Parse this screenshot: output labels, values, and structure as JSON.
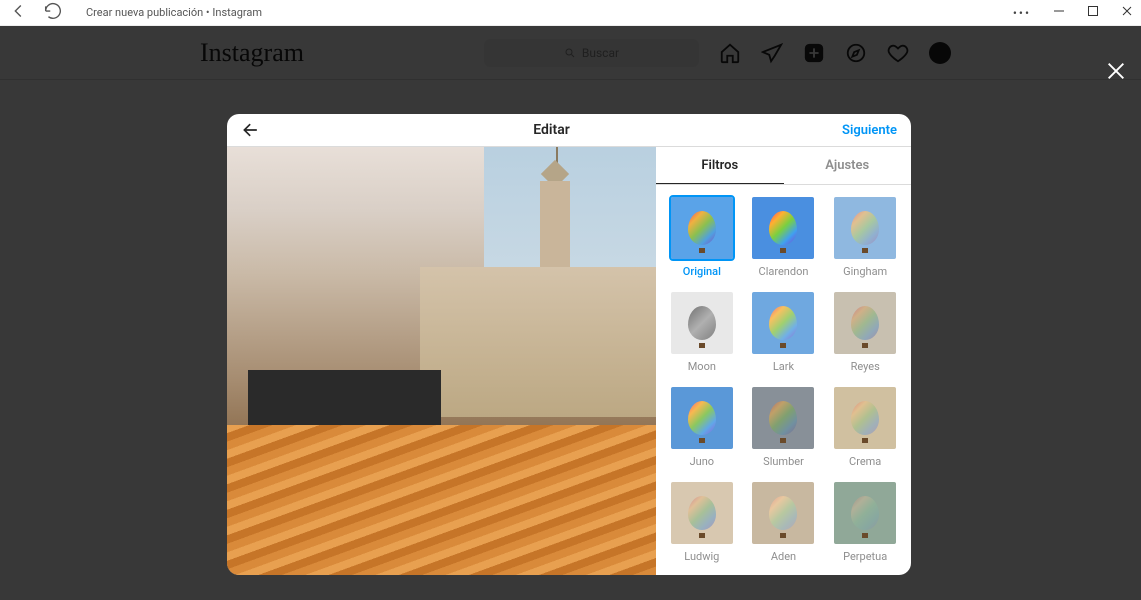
{
  "window": {
    "title": "Crear nueva publicación • Instagram",
    "more_icon": "more-icon",
    "minimize_icon": "minimize-icon",
    "maximize_icon": "maximize-icon",
    "close_icon": "close-icon"
  },
  "topbar": {
    "brand": "Instagram",
    "search_placeholder": "Buscar"
  },
  "modal": {
    "title": "Editar",
    "next": "Siguiente",
    "tab_filters": "Filtros",
    "tab_adjust": "Ajustes",
    "filters": [
      {
        "label": "Original",
        "bg": "bg-original",
        "bal": "bal-original",
        "selected": true
      },
      {
        "label": "Clarendon",
        "bg": "bg-clarendon",
        "bal": "bal-clarendon",
        "selected": false
      },
      {
        "label": "Gingham",
        "bg": "bg-gingham",
        "bal": "bal-gingham",
        "selected": false
      },
      {
        "label": "Moon",
        "bg": "bg-moon",
        "bal": "bal-moon",
        "selected": false
      },
      {
        "label": "Lark",
        "bg": "bg-lark",
        "bal": "bal-lark",
        "selected": false
      },
      {
        "label": "Reyes",
        "bg": "bg-reyes",
        "bal": "bal-reyes",
        "selected": false
      },
      {
        "label": "Juno",
        "bg": "bg-juno",
        "bal": "bal-juno",
        "selected": false
      },
      {
        "label": "Slumber",
        "bg": "bg-slumber",
        "bal": "bal-slumber",
        "selected": false
      },
      {
        "label": "Crema",
        "bg": "bg-crema",
        "bal": "bal-crema",
        "selected": false
      },
      {
        "label": "Ludwig",
        "bg": "bg-ludwig",
        "bal": "bal-ludwig",
        "selected": false
      },
      {
        "label": "Aden",
        "bg": "bg-aden",
        "bal": "bal-aden",
        "selected": false
      },
      {
        "label": "Perpetua",
        "bg": "bg-perpetua",
        "bal": "bal-perpetua",
        "selected": false
      }
    ]
  }
}
